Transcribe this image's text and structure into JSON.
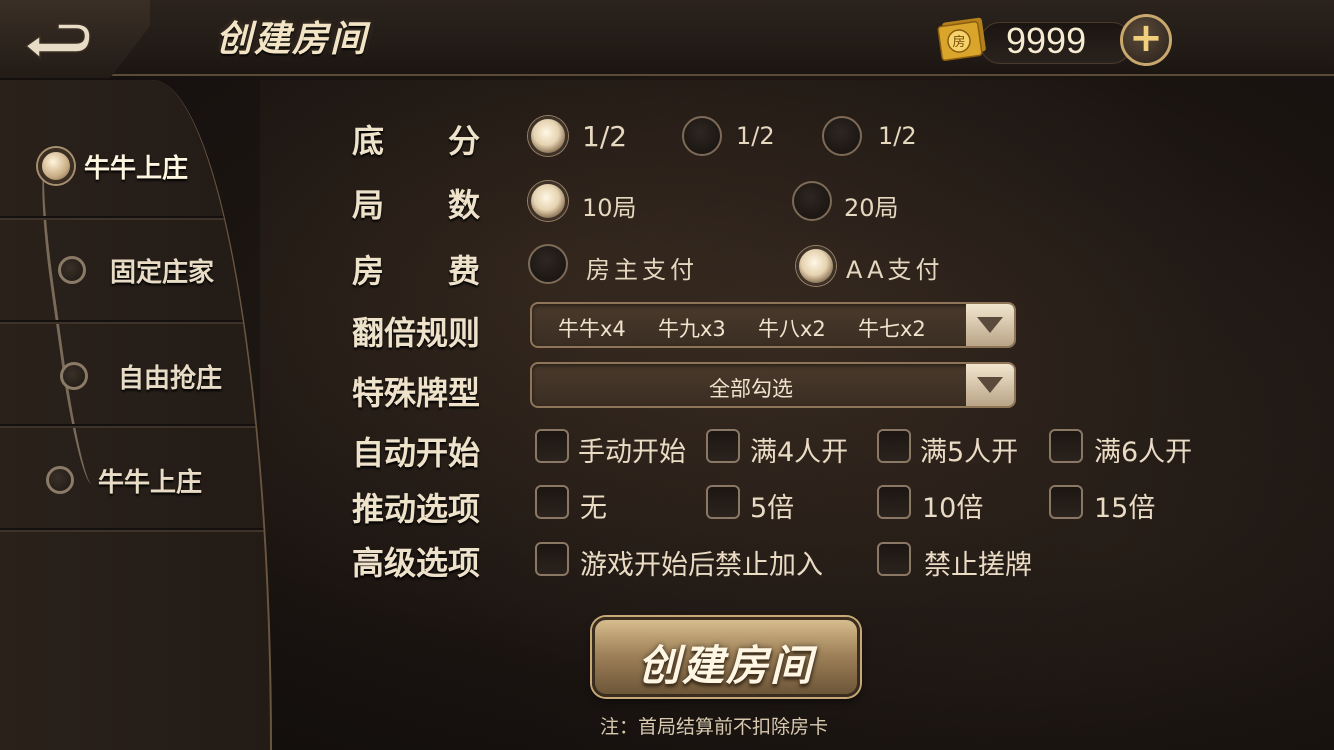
{
  "header": {
    "title": "创建房间",
    "currency_value": "9999",
    "card_icon_text": "房",
    "plus_label": "+"
  },
  "sidebar": {
    "items": [
      {
        "label": "牛牛上庄",
        "active": true
      },
      {
        "label": "固定庄家",
        "active": false
      },
      {
        "label": "自由抢庄",
        "active": false
      },
      {
        "label": "牛牛上庄",
        "active": false
      }
    ]
  },
  "form": {
    "base_score": {
      "label": "底　　分",
      "options": [
        "1/2",
        "1/2",
        "1/2"
      ],
      "selected": 0
    },
    "rounds": {
      "label": "局　　数",
      "options": [
        "10局",
        "20局"
      ],
      "selected": 0
    },
    "room_fee": {
      "label": "房　　费",
      "options": [
        "房主支付",
        "AA支付"
      ],
      "selected": 1
    },
    "multiplier_rules": {
      "label": "翻倍规则",
      "values": [
        "牛牛x4",
        "牛九x3",
        "牛八x2",
        "牛七x2"
      ]
    },
    "special_hands": {
      "label": "特殊牌型",
      "value": "全部勾选"
    },
    "auto_start": {
      "label": "自动开始",
      "options": [
        "手动开始",
        "满4人开",
        "满5人开",
        "满6人开"
      ]
    },
    "push_options": {
      "label": "推动选项",
      "options": [
        "无",
        "5倍",
        "10倍",
        "15倍"
      ]
    },
    "advanced_options": {
      "label": "高级选项",
      "options": [
        "游戏开始后禁止加入",
        "禁止搓牌"
      ]
    }
  },
  "create_button": {
    "label": "创建房间"
  },
  "note": "注：首局结算前不扣除房卡"
}
